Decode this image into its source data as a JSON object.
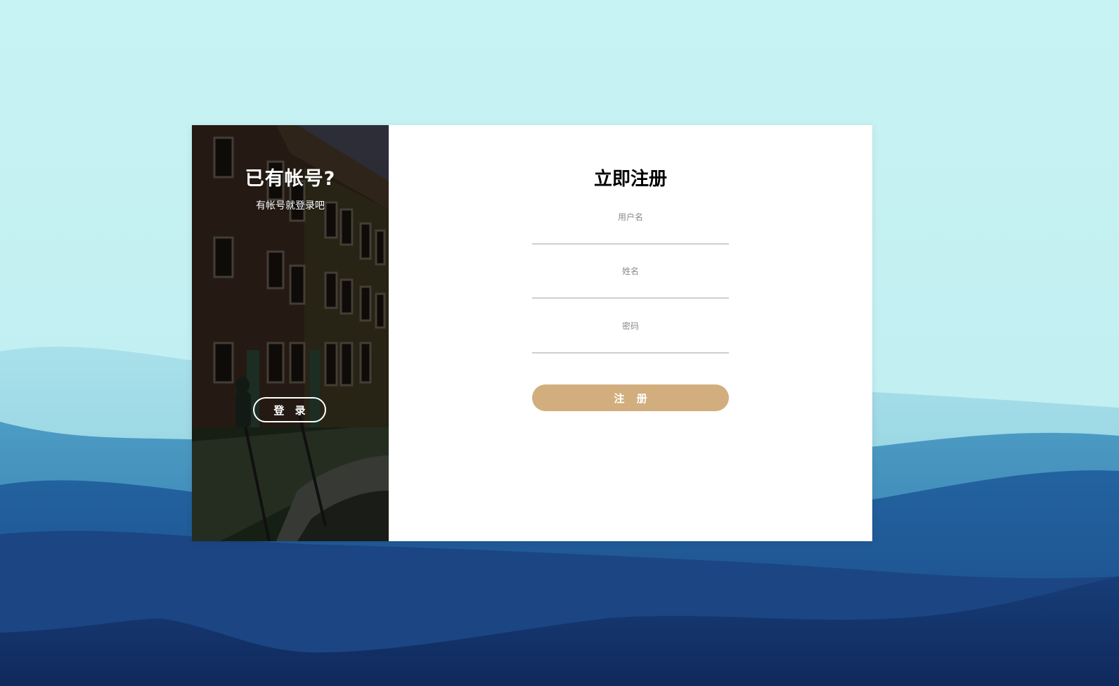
{
  "colors": {
    "sky": "#c6f1f3",
    "mountain_light": "#5aaec9",
    "mountain_mid": "#2a6ca4",
    "mountain_dark": "#1a4580",
    "mountain_darkest": "#0f2756",
    "accent_button": "#d2ae7e",
    "card_bg": "#ffffff"
  },
  "side_panel": {
    "title": "已有帐号?",
    "subtitle": "有帐号就登录吧",
    "login_button_label": "登 录"
  },
  "form": {
    "title": "立即注册",
    "fields": [
      {
        "label": "用户名",
        "value": ""
      },
      {
        "label": "姓名",
        "value": ""
      },
      {
        "label": "密码",
        "value": ""
      }
    ],
    "submit_label": "注 册"
  }
}
